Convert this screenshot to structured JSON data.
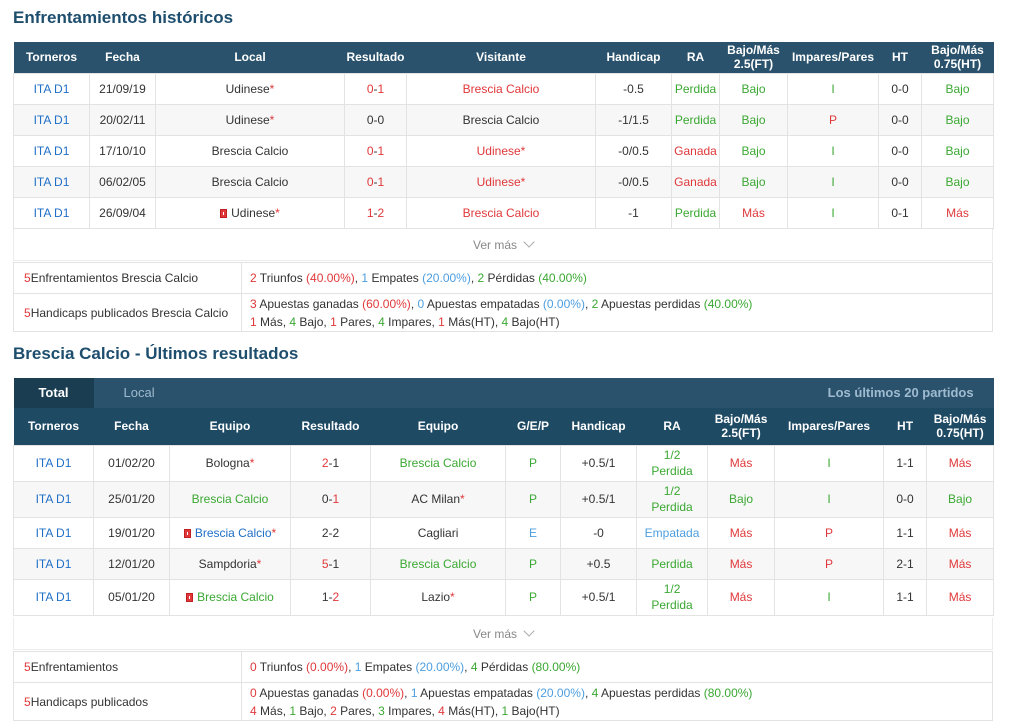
{
  "h2h": {
    "title": "Enfrentamientos históricos",
    "headers": [
      "Torneros",
      "Fecha",
      "Local",
      "Resultado",
      "Visitante",
      "Handicap",
      "RA",
      "Bajo/Más 2.5(FT)",
      "Impares/Pares",
      "HT",
      "Bajo/Más 0.75(HT)"
    ],
    "rows": [
      {
        "league": "ITA D1",
        "date": "21/09/19",
        "home": "Udinese",
        "score_home": "0",
        "score_sep": "-",
        "score_away": "1",
        "away": "Brescia Calcio",
        "handicap": "-0.5",
        "ra": "Perdida",
        "ou": "Bajo",
        "oe": "I",
        "ht": "0-0",
        "ouht": "Bajo"
      },
      {
        "league": "ITA D1",
        "date": "20/02/11",
        "home": "Udinese",
        "score_home": "0",
        "score_sep": "-",
        "score_away": "0",
        "away": "Brescia Calcio",
        "handicap": "-1/1.5",
        "ra": "Perdida",
        "ou": "Bajo",
        "oe": "P",
        "ht": "0-0",
        "ouht": "Bajo"
      },
      {
        "league": "ITA D1",
        "date": "17/10/10",
        "home": "Brescia Calcio",
        "score_home": "0",
        "score_sep": "-",
        "score_away": "1",
        "away": "Udinese",
        "handicap": "-0/0.5",
        "ra": "Ganada",
        "ou": "Bajo",
        "oe": "I",
        "ht": "0-0",
        "ouht": "Bajo"
      },
      {
        "league": "ITA D1",
        "date": "06/02/05",
        "home": "Brescia Calcio",
        "score_home": "0",
        "score_sep": "-",
        "score_away": "1",
        "away": "Udinese",
        "handicap": "-0/0.5",
        "ra": "Ganada",
        "ou": "Bajo",
        "oe": "I",
        "ht": "0-0",
        "ouht": "Bajo"
      },
      {
        "league": "ITA D1",
        "date": "26/09/04",
        "home": "Udinese",
        "score_home": "1",
        "score_sep": "-",
        "score_away": "2",
        "away": "Brescia Calcio",
        "handicap": "-1",
        "ra": "Perdida",
        "ou": "Más",
        "oe": "I",
        "ht": "0-1",
        "ouht": "Más"
      }
    ],
    "ver_mas": "Ver más",
    "summary": {
      "label1_num": "5",
      "label1": " Enfrentamientos Brescia Calcio",
      "label2_num": "5",
      "label2": " Handicaps publicados Brescia Calcio",
      "w": "2",
      "w_label": " Triunfos ",
      "w_pct": "(40.00%)",
      "d": "1",
      "d_label": " Empates ",
      "d_pct": "(20.00%)",
      "l": "2",
      "l_label": " Pérdidas ",
      "l_pct": "(40.00%)",
      "aw": "3",
      "aw_label": " Apuestas ganadas ",
      "aw_pct": "(60.00%)",
      "ad": "0",
      "ad_label": " Apuestas empatadas ",
      "ad_pct": "(0.00%)",
      "al": "2",
      "al_label": " Apuestas perdidas ",
      "al_pct": "(40.00%)",
      "mas": "1",
      "mas_label": " Más, ",
      "bajo": "4",
      "bajo_label": " Bajo, ",
      "pares": "1",
      "pares_label": " Pares, ",
      "impares": "4",
      "impares_label": " Impares, ",
      "masht": "1",
      "masht_label": " Más(HT), ",
      "bajoht": "4",
      "bajoht_label": " Bajo(HT)"
    }
  },
  "recent": {
    "title": "Brescia Calcio - Últimos resultados",
    "tab_total": "Total",
    "tab_local": "Local",
    "last_label": "Los últimos 20 partidos",
    "headers": [
      "Torneros",
      "Fecha",
      "Equipo",
      "Resultado",
      "Equipo",
      "G/E/P",
      "Handicap",
      "RA",
      "Bajo/Más 2.5(FT)",
      "Impares/Pares",
      "HT",
      "Bajo/Más 0.75(HT)"
    ],
    "rows": [
      {
        "league": "ITA D1",
        "date": "01/02/20",
        "home": "Bologna",
        "score_home": "2",
        "score_sep": "-",
        "score_away": "1",
        "away": "Brescia Calcio",
        "gep": "P",
        "handicap": "+0.5/1",
        "ra1": "1/2",
        "ra2": "Perdida",
        "ou": "Más",
        "oe": "I",
        "ht": "1-1",
        "ouht": "Más"
      },
      {
        "league": "ITA D1",
        "date": "25/01/20",
        "home": "Brescia Calcio",
        "score_home": "0",
        "score_sep": "-",
        "score_away": "1",
        "away": "AC Milan",
        "gep": "P",
        "handicap": "+0.5/1",
        "ra1": "1/2",
        "ra2": "Perdida",
        "ou": "Bajo",
        "oe": "I",
        "ht": "0-0",
        "ouht": "Bajo"
      },
      {
        "league": "ITA D1",
        "date": "19/01/20",
        "home": "Brescia Calcio",
        "score_home": "2",
        "score_sep": "-",
        "score_away": "2",
        "away": "Cagliari",
        "gep": "E",
        "handicap": "-0",
        "ra2": "Empatada",
        "ou": "Más",
        "oe": "P",
        "ht": "1-1",
        "ouht": "Más"
      },
      {
        "league": "ITA D1",
        "date": "12/01/20",
        "home": "Sampdoria",
        "score_home": "5",
        "score_sep": "-",
        "score_away": "1",
        "away": "Brescia Calcio",
        "gep": "P",
        "handicap": "+0.5",
        "ra2": "Perdida",
        "ou": "Más",
        "oe": "P",
        "ht": "2-1",
        "ouht": "Más"
      },
      {
        "league": "ITA D1",
        "date": "05/01/20",
        "home": "Brescia Calcio",
        "score_home": "1",
        "score_sep": "-",
        "score_away": "2",
        "away": "Lazio",
        "gep": "P",
        "handicap": "+0.5/1",
        "ra1": "1/2",
        "ra2": "Perdida",
        "ou": "Más",
        "oe": "I",
        "ht": "1-1",
        "ouht": "Más"
      }
    ],
    "ver_mas": "Ver más",
    "summary": {
      "label1_num": "5",
      "label1": " Enfrentamientos",
      "label2_num": "5",
      "label2": " Handicaps publicados",
      "w": "0",
      "w_label": " Triunfos ",
      "w_pct": "(0.00%)",
      "d": "1",
      "d_label": " Empates ",
      "d_pct": "(20.00%)",
      "l": "4",
      "l_label": " Pérdidas ",
      "l_pct": "(80.00%)",
      "aw": "0",
      "aw_label": " Apuestas ganadas ",
      "aw_pct": "(0.00%)",
      "ad": "1",
      "ad_label": " Apuestas empatadas ",
      "ad_pct": "(20.00%)",
      "al": "4",
      "al_label": " Apuestas perdidas ",
      "al_pct": "(80.00%)",
      "mas": "4",
      "mas_label": " Más, ",
      "bajo": "1",
      "bajo_label": " Bajo, ",
      "pares": "2",
      "pares_label": " Pares, ",
      "impares": "3",
      "impares_label": " Impares, ",
      "masht": "4",
      "masht_label": " Más(HT), ",
      "bajoht": "1",
      "bajoht_label": " Bajo(HT)"
    }
  },
  "star": "*",
  "colors": {
    "header": "#2a526c",
    "blue": "#1f6fc7",
    "red": "#e0383a",
    "green": "#3aa832",
    "lightblue": "#4d9ee0"
  }
}
